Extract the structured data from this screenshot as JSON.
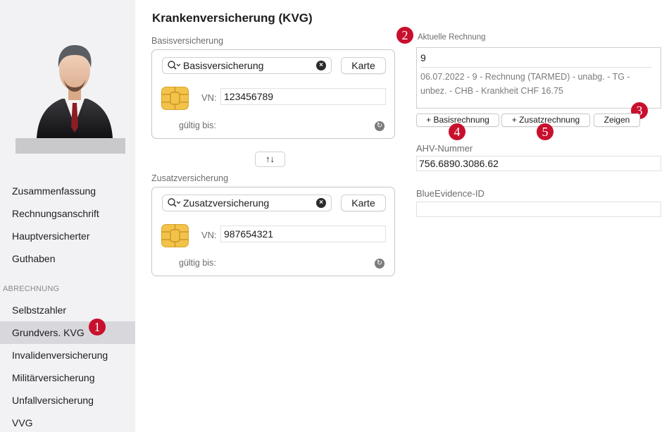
{
  "sidebar": {
    "items": [
      {
        "label": "Zusammenfassung"
      },
      {
        "label": "Rechnungsanschrift"
      },
      {
        "label": "Hauptversicherter"
      },
      {
        "label": "Guthaben"
      }
    ],
    "section_title": "ABRECHNUNG",
    "billing_items": [
      {
        "label": "Selbstzahler"
      },
      {
        "label": "Grundvers. KVG",
        "active": true
      },
      {
        "label": "Invalidenversicherung"
      },
      {
        "label": "Militärversicherung"
      },
      {
        "label": "Unfallversicherung"
      },
      {
        "label": "VVG"
      }
    ]
  },
  "badges": [
    "1",
    "2",
    "3",
    "4",
    "5"
  ],
  "main": {
    "title": "Krankenversicherung (KVG)",
    "basis": {
      "label": "Basisversicherung",
      "search_value": "Basisversicherung",
      "karte_label": "Karte",
      "vn_label": "VN:",
      "vn_value": "123456789",
      "gueltig_label": "gültig bis:"
    },
    "swap_label": "↑↓",
    "zusatz": {
      "label": "Zusatzversicherung",
      "search_value": "Zusatzversicherung",
      "karte_label": "Karte",
      "vn_label": "VN:",
      "vn_value": "987654321",
      "gueltig_label": "gültig bis:"
    },
    "invoice": {
      "label": "Aktuelle Rechnung",
      "number": "9",
      "description": "06.07.2022 - 9 - Rechnung (TARMED) - unabg. - TG - unbez. - CHB - Krankheit CHF 16.75"
    },
    "buttons": {
      "basis": "+ Basisrechnung",
      "zusatz": "+ Zusatzrechnung",
      "zeigen": "Zeigen"
    },
    "ahv": {
      "label": "AHV-Nummer",
      "value": "756.6890.3086.62"
    },
    "blue": {
      "label": "BlueEvidence-ID",
      "value": ""
    }
  },
  "colors": {
    "badge": "#c8102e",
    "sidebar_bg": "#f2f2f4",
    "active_bg": "#d7d7dc"
  }
}
